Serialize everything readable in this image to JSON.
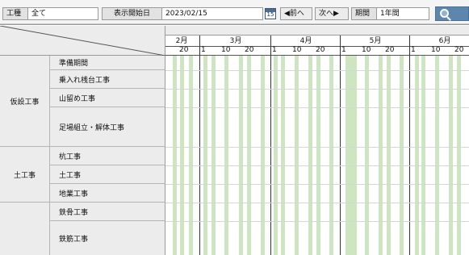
{
  "toolbar": {
    "work_type_label": "工種",
    "work_type_value": "全て",
    "start_date_label": "表示開始日",
    "start_date_value": "2023/02/15",
    "calendar_day": "15",
    "prev_label": "◀前へ",
    "next_label": "次へ▶",
    "period_label": "期間",
    "period_value": "1年間"
  },
  "timeline": {
    "months": [
      "2月",
      "3月",
      "4月",
      "5月",
      "6月"
    ],
    "tick_labels": [
      "20",
      "1",
      "10",
      "20",
      "1",
      "10",
      "20",
      "1",
      "10",
      "20",
      "1",
      "10",
      "20"
    ]
  },
  "categories": [
    {
      "name": "仮設工事",
      "items": [
        "準備期間",
        "乗入れ桟台工事",
        "山留め工事",
        "足場組立・解体工事"
      ]
    },
    {
      "name": "土工事",
      "items": [
        "杭工事",
        "土工事",
        "地業工事"
      ]
    },
    {
      "name": "",
      "items": [
        "鉄骨工事",
        "鉄筋工事"
      ]
    }
  ],
  "colors": {
    "holiday_stripe": "#cde5c0",
    "toolbar_bg": "#f4f4f4",
    "header_bg": "#ececec",
    "search_button": "#5d86ad"
  },
  "icons": {
    "calendar": "calendar-icon",
    "search": "search-icon"
  }
}
